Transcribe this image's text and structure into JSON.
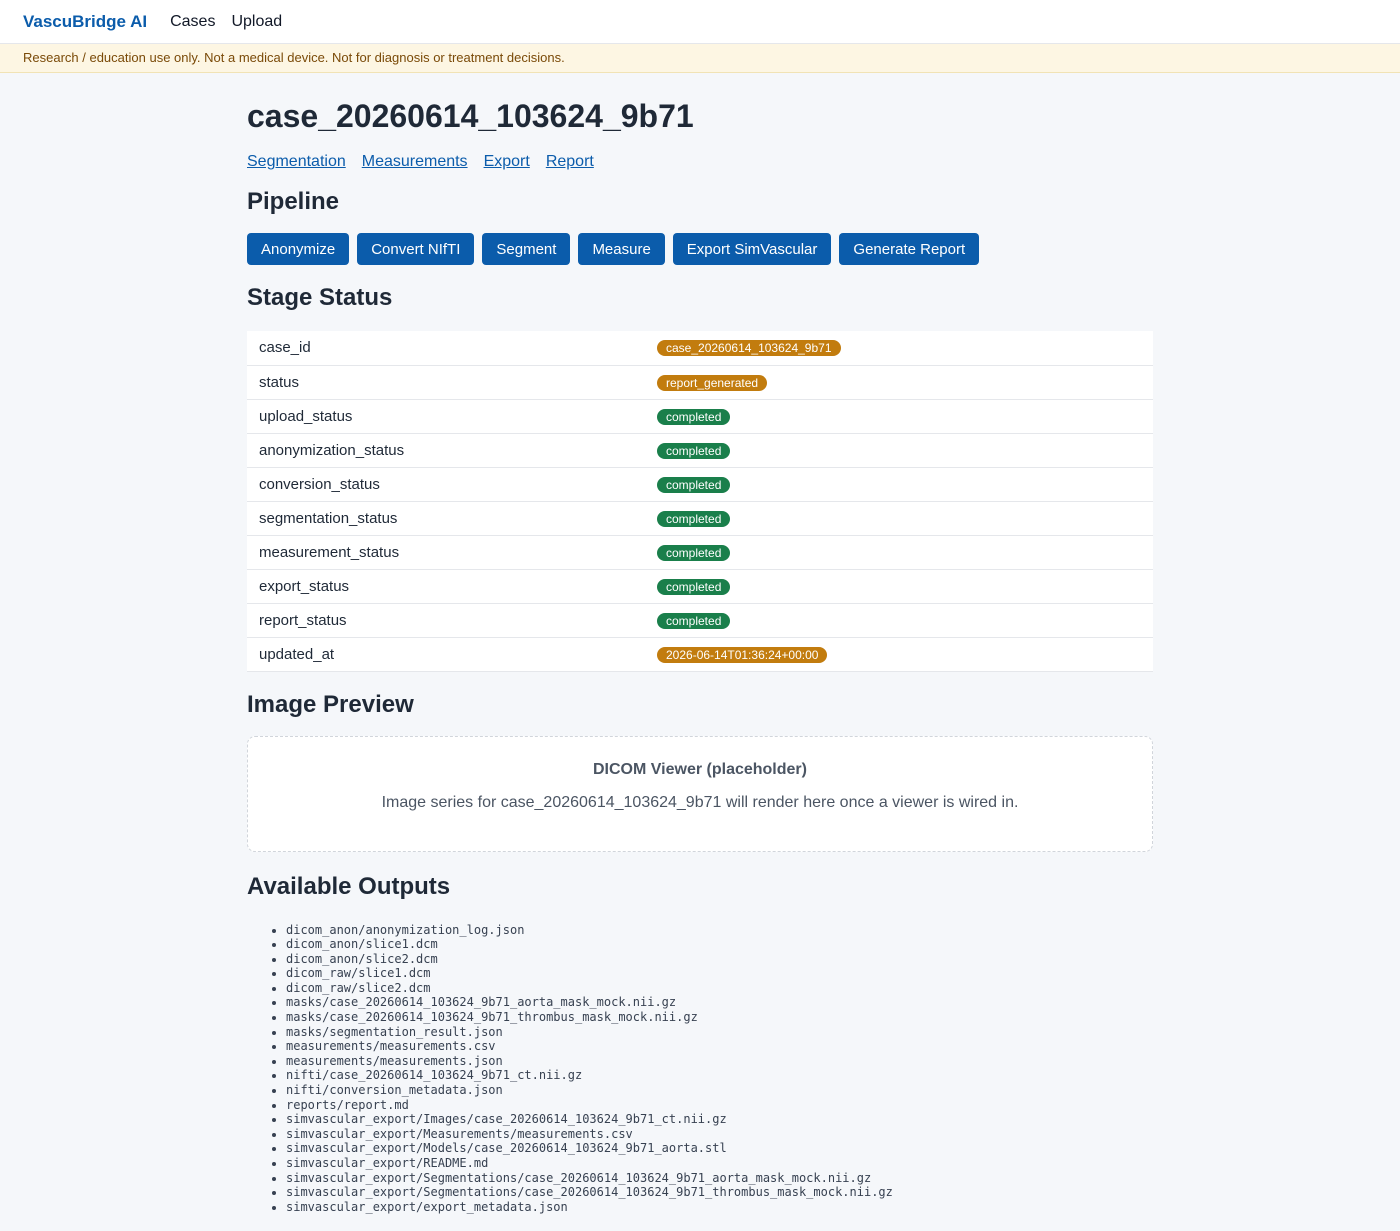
{
  "nav": {
    "brand": "VascuBridge AI",
    "links": [
      "Cases",
      "Upload"
    ]
  },
  "disclaimer": "Research / education use only. Not a medical device. Not for diagnosis or treatment decisions.",
  "case": {
    "title": "case_20260614_103624_9b71",
    "tabs": [
      "Segmentation",
      "Measurements",
      "Export",
      "Report"
    ]
  },
  "pipeline": {
    "heading": "Pipeline",
    "buttons": [
      "Anonymize",
      "Convert NIfTI",
      "Segment",
      "Measure",
      "Export SimVascular",
      "Generate Report"
    ]
  },
  "stage_status": {
    "heading": "Stage Status",
    "rows": [
      {
        "key": "case_id",
        "value": "case_20260614_103624_9b71",
        "color": "#c27c0e"
      },
      {
        "key": "status",
        "value": "report_generated",
        "color": "#c27c0e"
      },
      {
        "key": "upload_status",
        "value": "completed",
        "color": "#1a7f4b"
      },
      {
        "key": "anonymization_status",
        "value": "completed",
        "color": "#1a7f4b"
      },
      {
        "key": "conversion_status",
        "value": "completed",
        "color": "#1a7f4b"
      },
      {
        "key": "segmentation_status",
        "value": "completed",
        "color": "#1a7f4b"
      },
      {
        "key": "measurement_status",
        "value": "completed",
        "color": "#1a7f4b"
      },
      {
        "key": "export_status",
        "value": "completed",
        "color": "#1a7f4b"
      },
      {
        "key": "report_status",
        "value": "completed",
        "color": "#1a7f4b"
      },
      {
        "key": "updated_at",
        "value": "2026-06-14T01:36:24+00:00",
        "color": "#c27c0e"
      }
    ]
  },
  "image_preview": {
    "heading": "Image Preview",
    "viewer_title": "DICOM Viewer (placeholder)",
    "viewer_text": "Image series for case_20260614_103624_9b71 will render here once a viewer is wired in."
  },
  "outputs": {
    "heading": "Available Outputs",
    "files": [
      "dicom_anon/anonymization_log.json",
      "dicom_anon/slice1.dcm",
      "dicom_anon/slice2.dcm",
      "dicom_raw/slice1.dcm",
      "dicom_raw/slice2.dcm",
      "masks/case_20260614_103624_9b71_aorta_mask_mock.nii.gz",
      "masks/case_20260614_103624_9b71_thrombus_mask_mock.nii.gz",
      "masks/segmentation_result.json",
      "measurements/measurements.csv",
      "measurements/measurements.json",
      "nifti/case_20260614_103624_9b71_ct.nii.gz",
      "nifti/conversion_metadata.json",
      "reports/report.md",
      "simvascular_export/Images/case_20260614_103624_9b71_ct.nii.gz",
      "simvascular_export/Measurements/measurements.csv",
      "simvascular_export/Models/case_20260614_103624_9b71_aorta.stl",
      "simvascular_export/README.md",
      "simvascular_export/Segmentations/case_20260614_103624_9b71_aorta_mask_mock.nii.gz",
      "simvascular_export/Segmentations/case_20260614_103624_9b71_thrombus_mask_mock.nii.gz",
      "simvascular_export/export_metadata.json"
    ]
  }
}
